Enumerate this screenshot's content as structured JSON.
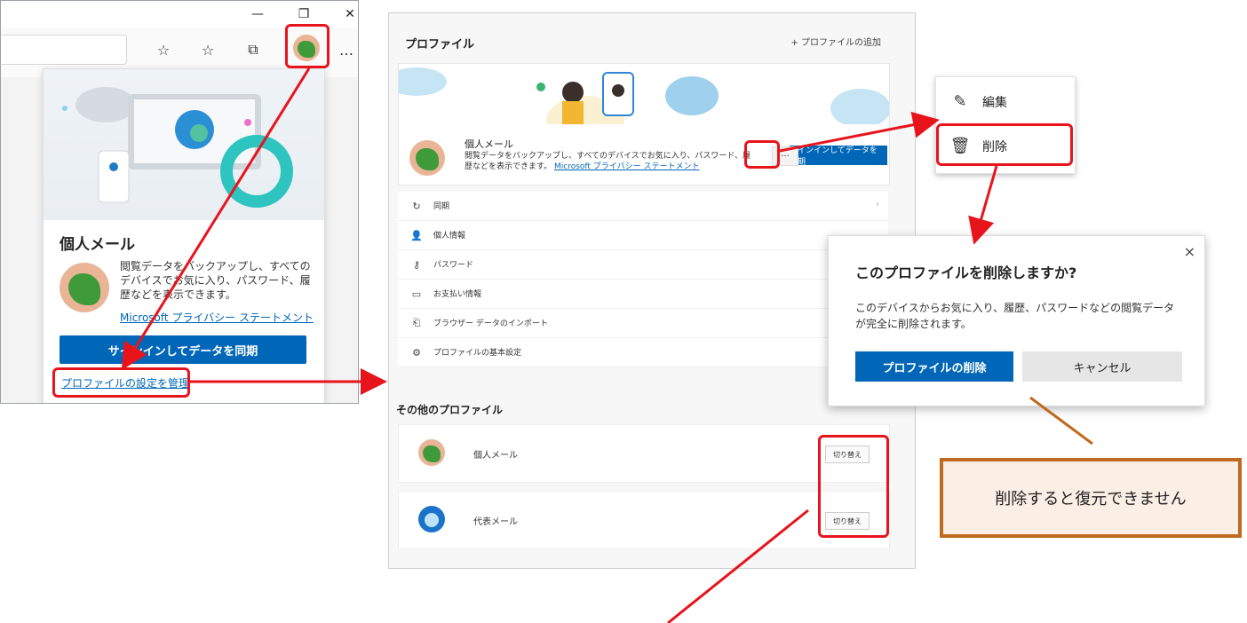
{
  "browser_popup": {
    "profile_name": "個人メール",
    "description": "閲覧データをバックアップし、すべてのデバイスでお気に入り、パスワード、履歴などを表示できます。",
    "privacy_link": "Microsoft プライバシー ステートメント",
    "signin_button": "サインインしてデータを同期",
    "manage_link": "プロファイルの設定を管理",
    "more_icon": "…"
  },
  "settings": {
    "title": "プロファイル",
    "add_profile": "+ プロファイルの追加",
    "card": {
      "name": "個人メール",
      "desc": "閲覧データをバックアップし、すべてのデバイスでお気に入り、パスワード、履歴などを表示できます。",
      "link": "Microsoft プライバシー ステートメント",
      "more": "···",
      "sync_button": "サインインしてデータを同期"
    },
    "rows": [
      {
        "label": "同期",
        "icon": "sync-icon"
      },
      {
        "label": "個人情報",
        "icon": "person-icon"
      },
      {
        "label": "パスワード",
        "icon": "key-icon"
      },
      {
        "label": "お支払い情報",
        "icon": "card-icon"
      },
      {
        "label": "ブラウザー データのインポート",
        "icon": "import-icon"
      },
      {
        "label": "プロファイルの基本設定",
        "icon": "profile-prefs-icon"
      }
    ],
    "other_title": "その他のプロファイル",
    "other_profiles": [
      {
        "name": "個人メール",
        "button": "切り替え"
      },
      {
        "name": "代表メール",
        "button": "切り替え"
      }
    ]
  },
  "context_menu": {
    "edit": "編集",
    "delete": "削除"
  },
  "dialog": {
    "title": "このプロファイルを削除しますか?",
    "message": "このデバイスからお気に入り、履歴、パスワードなどの閲覧データが完全に削除されます。",
    "delete_button": "プロファイルの削除",
    "cancel_button": "キャンセル",
    "close": "×"
  },
  "note": {
    "text": "削除すると復元できません"
  },
  "colors": {
    "accent_blue": "#0067b8",
    "highlight_red": "#e8141c",
    "note_border": "#c06a1f",
    "note_fill": "#fbeee5"
  }
}
